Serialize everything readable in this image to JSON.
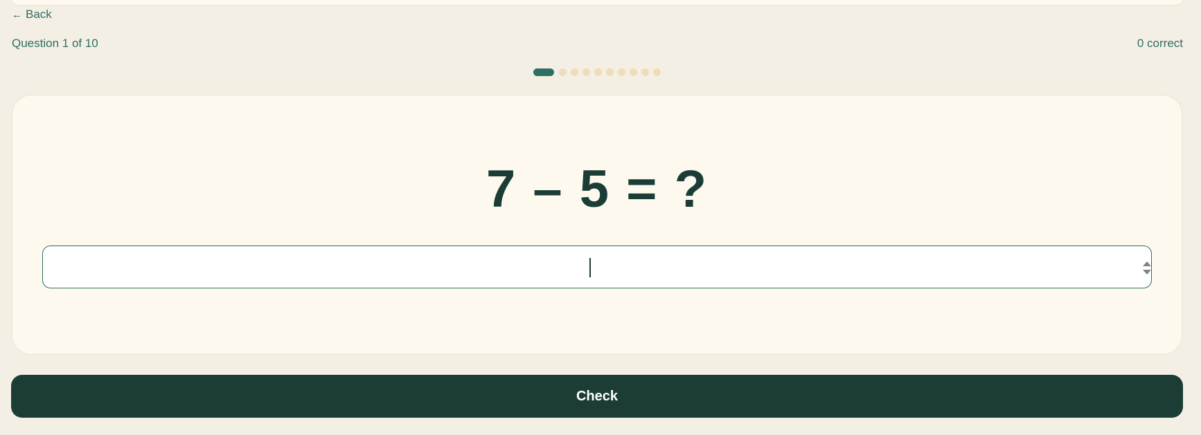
{
  "nav": {
    "back_arrow": "←",
    "back_label": "Back"
  },
  "progress": {
    "question_label": "Question 1 of 10",
    "correct_label": "0 correct",
    "current": 1,
    "total": 10
  },
  "question": {
    "equation": "7 – 5 = ?"
  },
  "answer": {
    "value": "",
    "placeholder": ""
  },
  "actions": {
    "check_label": "Check"
  },
  "colors": {
    "accent": "#2f6e63",
    "dark": "#1b3d36",
    "background": "#f4efe4",
    "card": "#fdf9ee",
    "dot_inactive": "#efdcb9"
  }
}
